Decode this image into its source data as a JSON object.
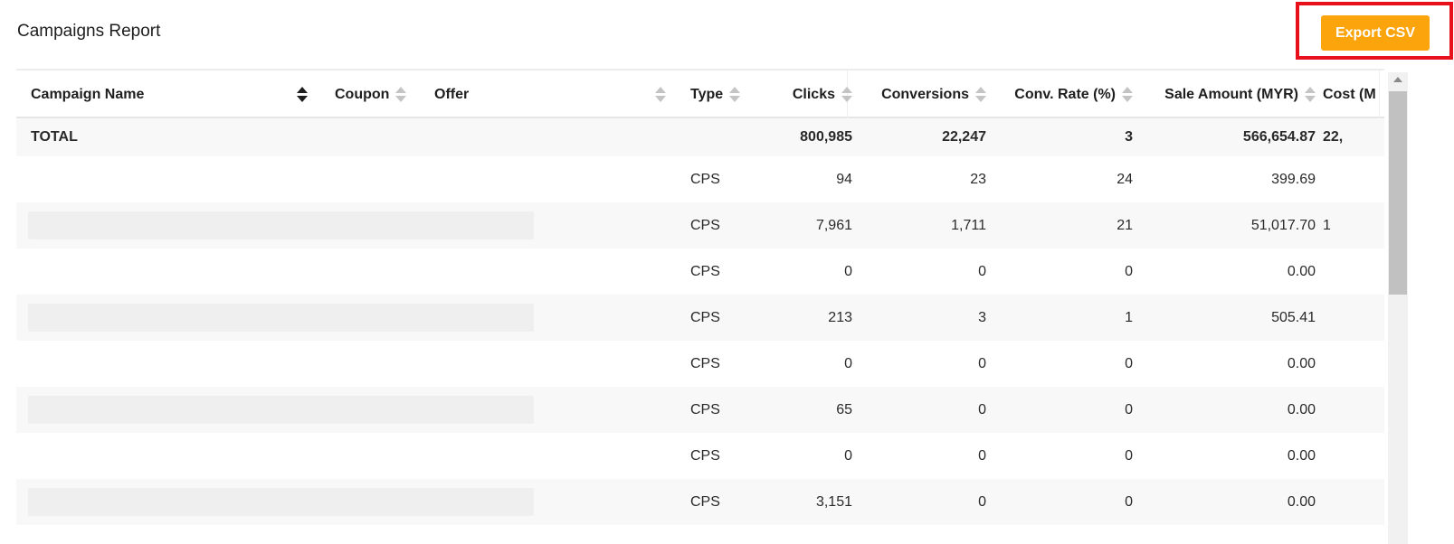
{
  "page": {
    "title": "Campaigns Report"
  },
  "toolbar": {
    "export_label": "Export CSV",
    "accent": "#fba40c",
    "highlight": "#e8101a"
  },
  "table": {
    "columns": [
      {
        "label": "Campaign Name",
        "sort": "asc"
      },
      {
        "label": "Coupon",
        "sort": "none"
      },
      {
        "label": "Offer",
        "sort": "none"
      },
      {
        "label": "Type",
        "sort": "none"
      },
      {
        "label": "Clicks",
        "sort": "none"
      },
      {
        "label": "Conversions",
        "sort": "none"
      },
      {
        "label": "Conv. Rate (%)",
        "sort": "none"
      },
      {
        "label": "Sale Amount (MYR)",
        "sort": "none"
      },
      {
        "label": "Cost (M",
        "sort": "none"
      }
    ],
    "total": {
      "label": "TOTAL",
      "clicks": "800,985",
      "conversions": "22,247",
      "conv_rate": "3",
      "sale_amount": "566,654.87",
      "cost": "22,"
    },
    "rows": [
      {
        "type": "CPS",
        "clicks": "94",
        "conversions": "23",
        "conv_rate": "24",
        "sale_amount": "399.69",
        "cost": "",
        "redacted": false
      },
      {
        "type": "CPS",
        "clicks": "7,961",
        "conversions": "1,711",
        "conv_rate": "21",
        "sale_amount": "51,017.70",
        "cost": "1",
        "redacted": true
      },
      {
        "type": "CPS",
        "clicks": "0",
        "conversions": "0",
        "conv_rate": "0",
        "sale_amount": "0.00",
        "cost": "",
        "redacted": false
      },
      {
        "type": "CPS",
        "clicks": "213",
        "conversions": "3",
        "conv_rate": "1",
        "sale_amount": "505.41",
        "cost": "",
        "redacted": true
      },
      {
        "type": "CPS",
        "clicks": "0",
        "conversions": "0",
        "conv_rate": "0",
        "sale_amount": "0.00",
        "cost": "",
        "redacted": false
      },
      {
        "type": "CPS",
        "clicks": "65",
        "conversions": "0",
        "conv_rate": "0",
        "sale_amount": "0.00",
        "cost": "",
        "redacted": true
      },
      {
        "type": "CPS",
        "clicks": "0",
        "conversions": "0",
        "conv_rate": "0",
        "sale_amount": "0.00",
        "cost": "",
        "redacted": false
      },
      {
        "type": "CPS",
        "clicks": "3,151",
        "conversions": "0",
        "conv_rate": "0",
        "sale_amount": "0.00",
        "cost": "",
        "redacted": true
      }
    ]
  }
}
